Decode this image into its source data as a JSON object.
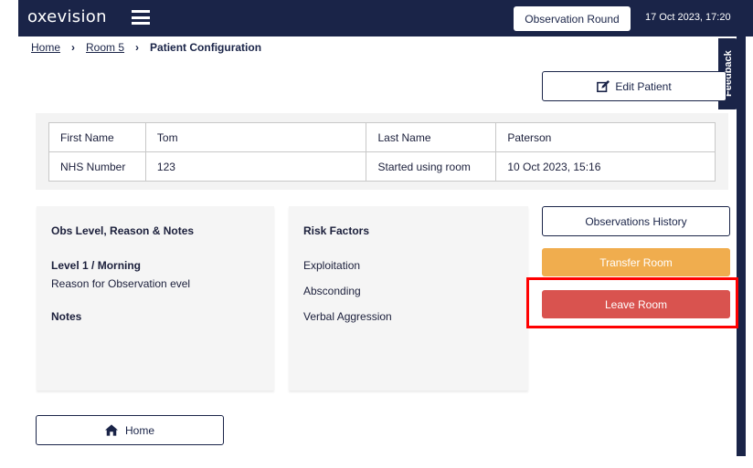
{
  "header": {
    "logo": "oxevision",
    "observation_round_label": "Observation Round",
    "datetime": "17 Oct 2023, 17:20",
    "icons": [
      "menu-icon"
    ]
  },
  "breadcrumb": {
    "items": [
      "Home",
      "Room 5"
    ],
    "current": "Patient Configuration"
  },
  "feedback_label": "Feedback",
  "edit_patient_label": "Edit Patient",
  "patient": {
    "rows": [
      [
        "First Name",
        "Tom",
        "Last Name",
        "Paterson"
      ],
      [
        "NHS Number",
        "123",
        "Started using room",
        "10 Oct 2023, 15:16"
      ]
    ]
  },
  "obs_card": {
    "title": "Obs Level, Reason & Notes",
    "level": "Level 1 / Morning",
    "reason": "Reason for Observation evel",
    "notes_label": "Notes"
  },
  "risk_card": {
    "title": "Risk Factors",
    "factors": [
      "Exploitation",
      "Absconding",
      "Verbal Aggression"
    ]
  },
  "actions": {
    "history_label": "Observations History",
    "transfer_label": "Transfer Room",
    "leave_label": "Leave Room",
    "home_label": "Home"
  },
  "colors": {
    "navy": "#1a2448",
    "transfer": "#f0ad4e",
    "leave": "#d9534f",
    "highlight": "#ff0000"
  }
}
